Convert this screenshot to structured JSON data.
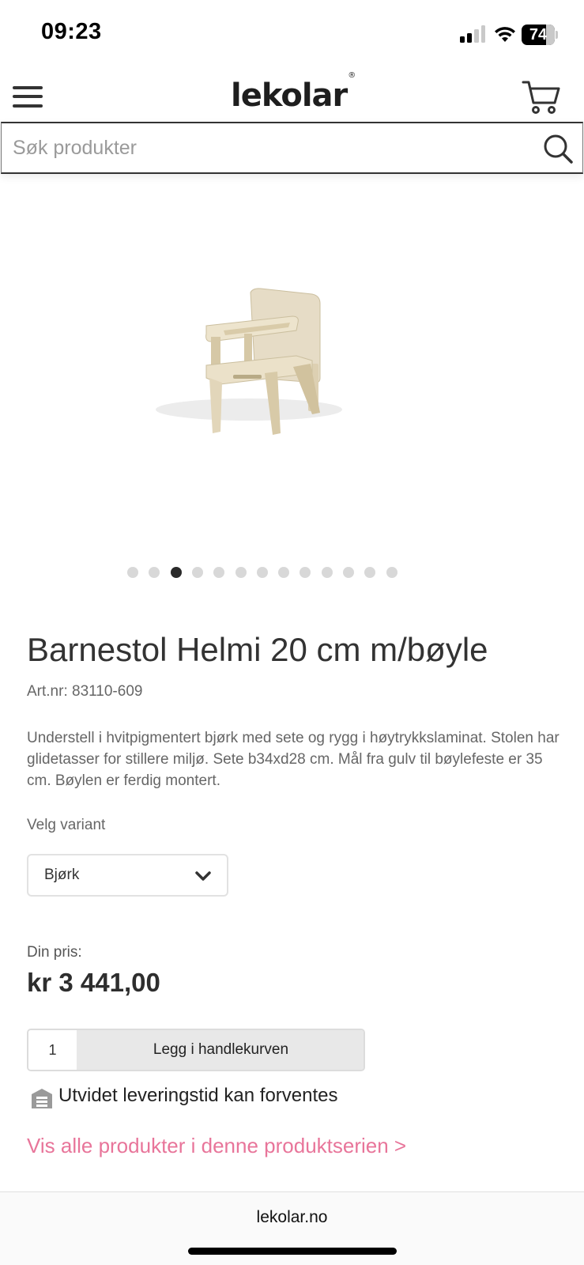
{
  "status_bar": {
    "time": "09:23",
    "battery": "74",
    "battery_level": 0.74
  },
  "header": {
    "logo": "lekolar",
    "logo_mark": "®",
    "menu_icon": "hamburger-menu-icon",
    "cart_icon": "shopping-cart-icon"
  },
  "search": {
    "placeholder": "Søk produkter",
    "value": "",
    "icon": "search-icon"
  },
  "gallery": {
    "image": "children's wooden high chair with tray",
    "dot_count": 13,
    "active_index": 2
  },
  "product": {
    "title": "Barnestol Helmi 20 cm m/bøyle",
    "art_nr": "Art.nr: 83110-609",
    "description": "Understell i hvitpigmentert bjørk med sete og rygg i høytrykkslaminat. Stolen har glidetasser for stillere miljø. Sete b34xd28 cm. Mål fra gulv til bøylefeste er 35 cm. Bøylen er ferdig montert.",
    "variant_label": "Velg variant",
    "variant_selected": "Bjørk",
    "price_label": "Din pris:",
    "price": "kr 3 441,00",
    "quantity": "1",
    "add_to_cart_label": "Legg i handlekurven",
    "delivery_note": "Utvidet leveringstid kan forventes",
    "series_link": "Vis alle produkter i denne produktserien >"
  },
  "browser": {
    "url": "lekolar.no"
  },
  "colors": {
    "accent_link": "#e8759a",
    "text_dark": "#2a2a2a",
    "button_bg": "#e8e8e8"
  }
}
